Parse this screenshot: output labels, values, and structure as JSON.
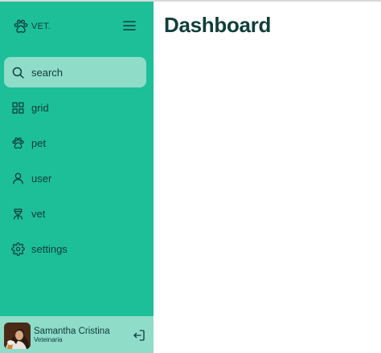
{
  "brand": {
    "name": "VET.",
    "icon": "paw-icon"
  },
  "sidebar": {
    "menu_icon": "hamburger-menu-icon",
    "items": [
      {
        "label": "search",
        "icon": "search-icon",
        "active": true
      },
      {
        "label": "grid",
        "icon": "grid-icon",
        "active": false
      },
      {
        "label": "pet",
        "icon": "paw-icon",
        "active": false
      },
      {
        "label": "user",
        "icon": "user-icon",
        "active": false
      },
      {
        "label": "vet",
        "icon": "vet-icon",
        "active": false
      },
      {
        "label": "settings",
        "icon": "gear-icon",
        "active": false
      }
    ]
  },
  "profile": {
    "name": "Samantha Cristina",
    "role": "Veteinaria",
    "logout_icon": "logout-icon"
  },
  "main": {
    "title": "Dashboard"
  },
  "colors": {
    "sidebar": "#1cbf98",
    "active_item": "#8fdcc8",
    "profile_bar": "#8fdcc8",
    "text_dark": "#0f3b38",
    "title": "#103f3b"
  }
}
